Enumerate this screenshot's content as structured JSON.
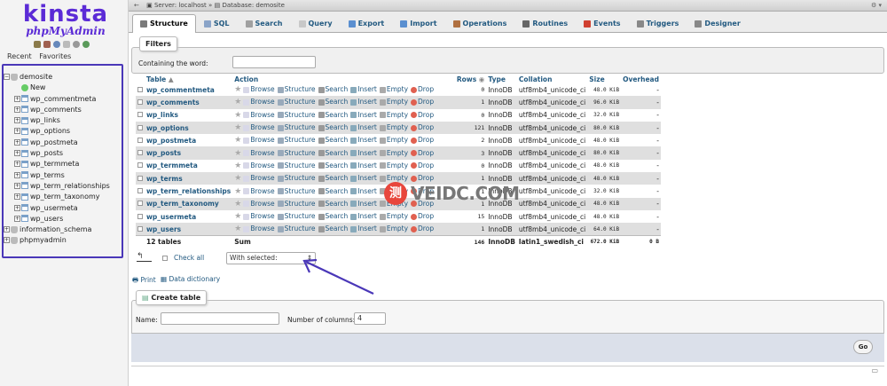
{
  "brand": {
    "name": "kinsta",
    "product": "phpMyAdmin"
  },
  "nav": {
    "recent": "Recent",
    "favorites": "Favorites",
    "tree": [
      {
        "label": "demosite",
        "level": 0,
        "type": "db",
        "expanded": true
      },
      {
        "label": "New",
        "level": 1,
        "type": "new"
      },
      {
        "label": "wp_commentmeta",
        "level": 1,
        "type": "table"
      },
      {
        "label": "wp_comments",
        "level": 1,
        "type": "table"
      },
      {
        "label": "wp_links",
        "level": 1,
        "type": "table"
      },
      {
        "label": "wp_options",
        "level": 1,
        "type": "table"
      },
      {
        "label": "wp_postmeta",
        "level": 1,
        "type": "table"
      },
      {
        "label": "wp_posts",
        "level": 1,
        "type": "table"
      },
      {
        "label": "wp_termmeta",
        "level": 1,
        "type": "table"
      },
      {
        "label": "wp_terms",
        "level": 1,
        "type": "table"
      },
      {
        "label": "wp_term_relationships",
        "level": 1,
        "type": "table"
      },
      {
        "label": "wp_term_taxonomy",
        "level": 1,
        "type": "table"
      },
      {
        "label": "wp_usermeta",
        "level": 1,
        "type": "table"
      },
      {
        "label": "wp_users",
        "level": 1,
        "type": "table"
      },
      {
        "label": "information_schema",
        "level": 0,
        "type": "db"
      },
      {
        "label": "phpmyadmin",
        "level": 0,
        "type": "db"
      }
    ]
  },
  "breadcrumb": {
    "server": "Server: localhost",
    "sep": "»",
    "database": "Database: demosite"
  },
  "tabs": [
    {
      "label": "Structure",
      "active": true,
      "color": "#7a7a7a"
    },
    {
      "label": "SQL",
      "color": "#8aa4c8"
    },
    {
      "label": "Search",
      "color": "#a0a0a0"
    },
    {
      "label": "Query",
      "color": "#c8c8c8"
    },
    {
      "label": "Export",
      "color": "#5a8fd0"
    },
    {
      "label": "Import",
      "color": "#5a8fd0"
    },
    {
      "label": "Operations",
      "color": "#b07040"
    },
    {
      "label": "Routines",
      "color": "#666"
    },
    {
      "label": "Events",
      "color": "#d04030"
    },
    {
      "label": "Triggers",
      "color": "#888"
    },
    {
      "label": "Designer",
      "color": "#888"
    }
  ],
  "filters": {
    "legend": "Filters",
    "label": "Containing the word:",
    "value": ""
  },
  "table": {
    "headers": {
      "table": "Table",
      "action": "Action",
      "rows": "Rows",
      "type": "Type",
      "collation": "Collation",
      "size": "Size",
      "overhead": "Overhead"
    },
    "actions": {
      "browse": "Browse",
      "structure": "Structure",
      "search": "Search",
      "insert": "Insert",
      "empty": "Empty",
      "drop": "Drop"
    },
    "rows": [
      {
        "name": "wp_commentmeta",
        "rows": "0",
        "type": "InnoDB",
        "collation": "utf8mb4_unicode_ci",
        "size": "48.0 KiB",
        "overhead": "-"
      },
      {
        "name": "wp_comments",
        "rows": "1",
        "type": "InnoDB",
        "collation": "utf8mb4_unicode_ci",
        "size": "96.0 KiB",
        "overhead": "-"
      },
      {
        "name": "wp_links",
        "rows": "0",
        "type": "InnoDB",
        "collation": "utf8mb4_unicode_ci",
        "size": "32.0 KiB",
        "overhead": "-"
      },
      {
        "name": "wp_options",
        "rows": "121",
        "type": "InnoDB",
        "collation": "utf8mb4_unicode_ci",
        "size": "80.0 KiB",
        "overhead": "-"
      },
      {
        "name": "wp_postmeta",
        "rows": "2",
        "type": "InnoDB",
        "collation": "utf8mb4_unicode_ci",
        "size": "48.0 KiB",
        "overhead": "-"
      },
      {
        "name": "wp_posts",
        "rows": "3",
        "type": "InnoDB",
        "collation": "utf8mb4_unicode_ci",
        "size": "80.0 KiB",
        "overhead": "-"
      },
      {
        "name": "wp_termmeta",
        "rows": "0",
        "type": "InnoDB",
        "collation": "utf8mb4_unicode_ci",
        "size": "48.0 KiB",
        "overhead": "-"
      },
      {
        "name": "wp_terms",
        "rows": "1",
        "type": "InnoDB",
        "collation": "utf8mb4_unicode_ci",
        "size": "48.0 KiB",
        "overhead": "-"
      },
      {
        "name": "wp_term_relationships",
        "rows": "1",
        "type": "InnoDB",
        "collation": "utf8mb4_unicode_ci",
        "size": "32.0 KiB",
        "overhead": "-"
      },
      {
        "name": "wp_term_taxonomy",
        "rows": "1",
        "type": "InnoDB",
        "collation": "utf8mb4_unicode_ci",
        "size": "48.0 KiB",
        "overhead": "-"
      },
      {
        "name": "wp_usermeta",
        "rows": "15",
        "type": "InnoDB",
        "collation": "utf8mb4_unicode_ci",
        "size": "48.0 KiB",
        "overhead": "-"
      },
      {
        "name": "wp_users",
        "rows": "1",
        "type": "InnoDB",
        "collation": "utf8mb4_unicode_ci",
        "size": "64.0 KiB",
        "overhead": "-"
      }
    ],
    "summary": {
      "count": "12 tables",
      "label": "Sum",
      "rows": "146",
      "type": "InnoDB",
      "collation": "latin1_swedish_ci",
      "size": "672.0 KiB",
      "overhead": "0 B"
    }
  },
  "bulk": {
    "check_all": "Check all",
    "with_selected": "With selected:"
  },
  "links": {
    "print": "Print",
    "data_dictionary": "Data dictionary"
  },
  "create_table": {
    "legend": "Create table",
    "name_label": "Name:",
    "name_value": "",
    "columns_label": "Number of columns:",
    "columns_value": "4",
    "go": "Go"
  },
  "watermark": {
    "glyph": "测",
    "text": "VEIDC.COM"
  },
  "annotation_color": "#4a37b8"
}
